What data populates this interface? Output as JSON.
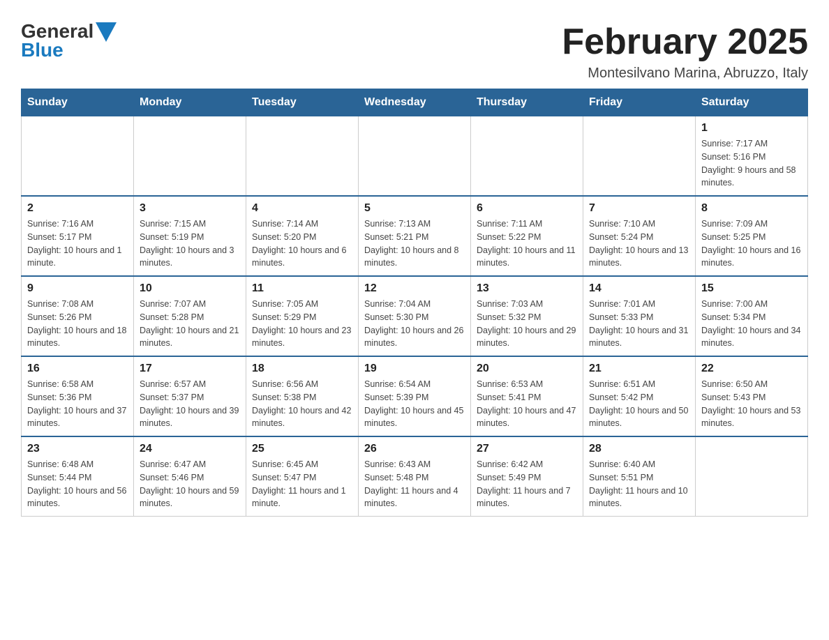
{
  "header": {
    "logo_line1": "General",
    "logo_line2": "Blue",
    "month_title": "February 2025",
    "location": "Montesilvano Marina, Abruzzo, Italy"
  },
  "weekdays": [
    "Sunday",
    "Monday",
    "Tuesday",
    "Wednesday",
    "Thursday",
    "Friday",
    "Saturday"
  ],
  "weeks": [
    [
      {
        "day": "",
        "info": ""
      },
      {
        "day": "",
        "info": ""
      },
      {
        "day": "",
        "info": ""
      },
      {
        "day": "",
        "info": ""
      },
      {
        "day": "",
        "info": ""
      },
      {
        "day": "",
        "info": ""
      },
      {
        "day": "1",
        "info": "Sunrise: 7:17 AM\nSunset: 5:16 PM\nDaylight: 9 hours and 58 minutes."
      }
    ],
    [
      {
        "day": "2",
        "info": "Sunrise: 7:16 AM\nSunset: 5:17 PM\nDaylight: 10 hours and 1 minute."
      },
      {
        "day": "3",
        "info": "Sunrise: 7:15 AM\nSunset: 5:19 PM\nDaylight: 10 hours and 3 minutes."
      },
      {
        "day": "4",
        "info": "Sunrise: 7:14 AM\nSunset: 5:20 PM\nDaylight: 10 hours and 6 minutes."
      },
      {
        "day": "5",
        "info": "Sunrise: 7:13 AM\nSunset: 5:21 PM\nDaylight: 10 hours and 8 minutes."
      },
      {
        "day": "6",
        "info": "Sunrise: 7:11 AM\nSunset: 5:22 PM\nDaylight: 10 hours and 11 minutes."
      },
      {
        "day": "7",
        "info": "Sunrise: 7:10 AM\nSunset: 5:24 PM\nDaylight: 10 hours and 13 minutes."
      },
      {
        "day": "8",
        "info": "Sunrise: 7:09 AM\nSunset: 5:25 PM\nDaylight: 10 hours and 16 minutes."
      }
    ],
    [
      {
        "day": "9",
        "info": "Sunrise: 7:08 AM\nSunset: 5:26 PM\nDaylight: 10 hours and 18 minutes."
      },
      {
        "day": "10",
        "info": "Sunrise: 7:07 AM\nSunset: 5:28 PM\nDaylight: 10 hours and 21 minutes."
      },
      {
        "day": "11",
        "info": "Sunrise: 7:05 AM\nSunset: 5:29 PM\nDaylight: 10 hours and 23 minutes."
      },
      {
        "day": "12",
        "info": "Sunrise: 7:04 AM\nSunset: 5:30 PM\nDaylight: 10 hours and 26 minutes."
      },
      {
        "day": "13",
        "info": "Sunrise: 7:03 AM\nSunset: 5:32 PM\nDaylight: 10 hours and 29 minutes."
      },
      {
        "day": "14",
        "info": "Sunrise: 7:01 AM\nSunset: 5:33 PM\nDaylight: 10 hours and 31 minutes."
      },
      {
        "day": "15",
        "info": "Sunrise: 7:00 AM\nSunset: 5:34 PM\nDaylight: 10 hours and 34 minutes."
      }
    ],
    [
      {
        "day": "16",
        "info": "Sunrise: 6:58 AM\nSunset: 5:36 PM\nDaylight: 10 hours and 37 minutes."
      },
      {
        "day": "17",
        "info": "Sunrise: 6:57 AM\nSunset: 5:37 PM\nDaylight: 10 hours and 39 minutes."
      },
      {
        "day": "18",
        "info": "Sunrise: 6:56 AM\nSunset: 5:38 PM\nDaylight: 10 hours and 42 minutes."
      },
      {
        "day": "19",
        "info": "Sunrise: 6:54 AM\nSunset: 5:39 PM\nDaylight: 10 hours and 45 minutes."
      },
      {
        "day": "20",
        "info": "Sunrise: 6:53 AM\nSunset: 5:41 PM\nDaylight: 10 hours and 47 minutes."
      },
      {
        "day": "21",
        "info": "Sunrise: 6:51 AM\nSunset: 5:42 PM\nDaylight: 10 hours and 50 minutes."
      },
      {
        "day": "22",
        "info": "Sunrise: 6:50 AM\nSunset: 5:43 PM\nDaylight: 10 hours and 53 minutes."
      }
    ],
    [
      {
        "day": "23",
        "info": "Sunrise: 6:48 AM\nSunset: 5:44 PM\nDaylight: 10 hours and 56 minutes."
      },
      {
        "day": "24",
        "info": "Sunrise: 6:47 AM\nSunset: 5:46 PM\nDaylight: 10 hours and 59 minutes."
      },
      {
        "day": "25",
        "info": "Sunrise: 6:45 AM\nSunset: 5:47 PM\nDaylight: 11 hours and 1 minute."
      },
      {
        "day": "26",
        "info": "Sunrise: 6:43 AM\nSunset: 5:48 PM\nDaylight: 11 hours and 4 minutes."
      },
      {
        "day": "27",
        "info": "Sunrise: 6:42 AM\nSunset: 5:49 PM\nDaylight: 11 hours and 7 minutes."
      },
      {
        "day": "28",
        "info": "Sunrise: 6:40 AM\nSunset: 5:51 PM\nDaylight: 11 hours and 10 minutes."
      },
      {
        "day": "",
        "info": ""
      }
    ]
  ]
}
